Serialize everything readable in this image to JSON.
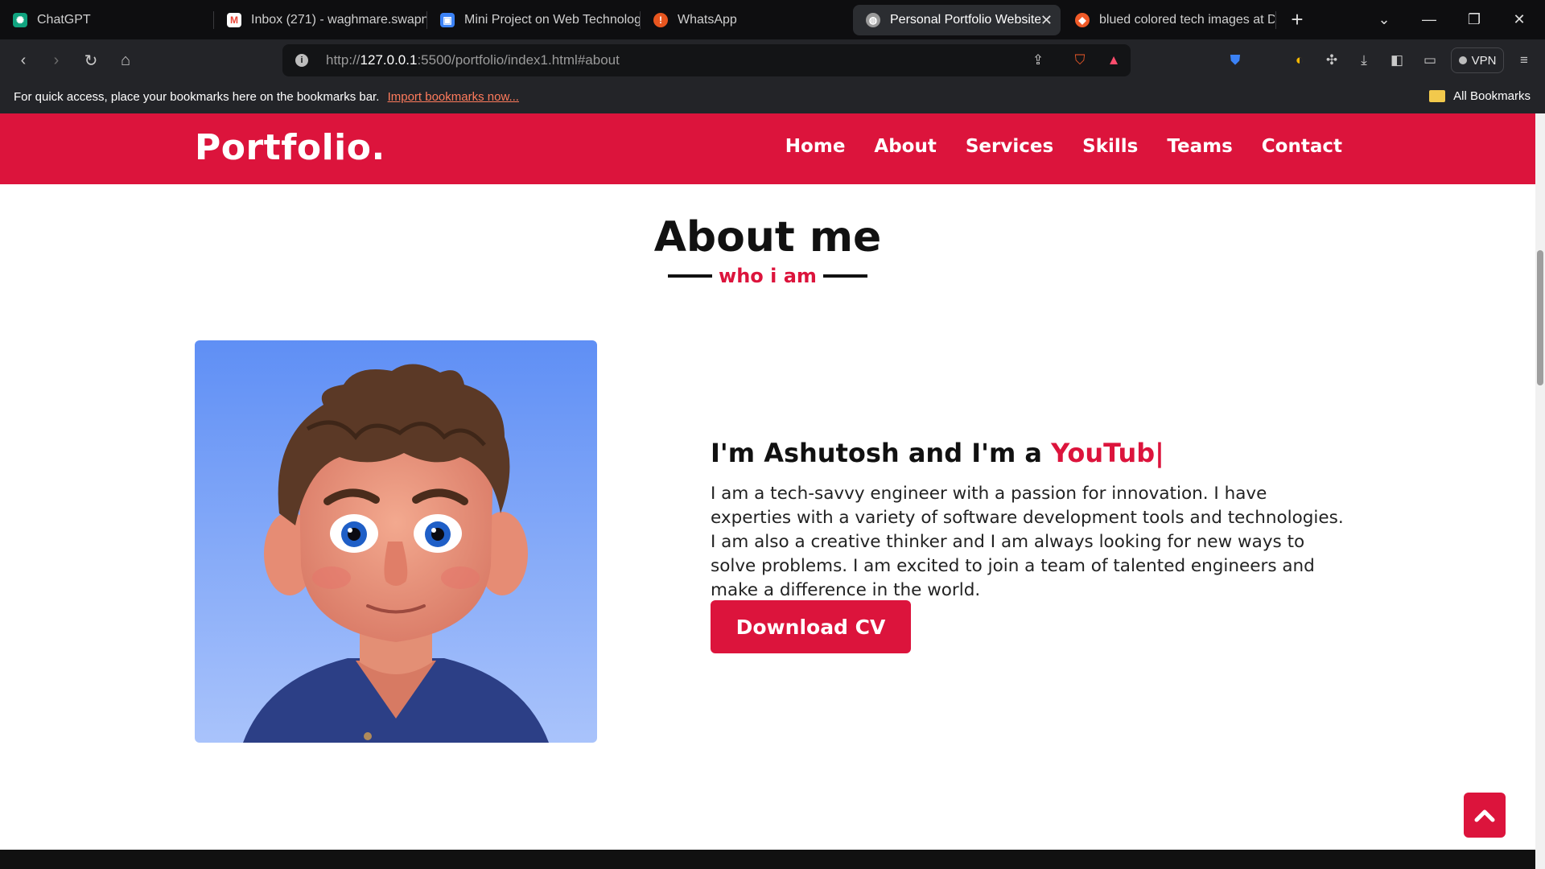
{
  "browser": {
    "tabs": [
      {
        "title": "ChatGPT",
        "icon": "chatgpt-icon",
        "color": "#10a37f"
      },
      {
        "title": "Inbox (271) - waghmare.swapni",
        "icon": "gmail-icon",
        "color": "#ea4335"
      },
      {
        "title": "Mini Project on Web Technolog",
        "icon": "classroom-icon",
        "color": "#3b82f6"
      },
      {
        "title": "WhatsApp",
        "icon": "whatsapp-icon",
        "color": "#e8561f"
      },
      {
        "title": "Personal Portfolio Website",
        "icon": "globe-icon",
        "color": "#9a9a9a"
      },
      {
        "title": "blued colored tech images at D",
        "icon": "brave-icon",
        "color": "#f05a28"
      }
    ],
    "url_prefix": "http://",
    "url_host": "127.0.0.1",
    "url_rest": ":5500/portfolio/index1.html#about",
    "bookmarks_message": "For quick access, place your bookmarks here on the bookmarks bar.",
    "bookmarks_link": "Import bookmarks now...",
    "all_bookmarks": "All Bookmarks",
    "vpn_label": "VPN"
  },
  "site": {
    "logo": "Portfolio.",
    "nav": [
      "Home",
      "About",
      "Services",
      "Skills",
      "Teams",
      "Contact"
    ],
    "about": {
      "title": "About me",
      "subtitle": "who i am",
      "intro_prefix": "I'm Ashutosh and I'm a ",
      "intro_highlight": "YouTub|",
      "bio": "I am a tech-savvy engineer with a passion for innovation. I have experties with a variety of software development tools and technologies. I am also a creative thinker and I am always looking for new ways to solve problems. I am excited to join a team of talented engineers and make a difference in the world.",
      "cta": "Download CV"
    },
    "accent_color": "#dc143c"
  }
}
